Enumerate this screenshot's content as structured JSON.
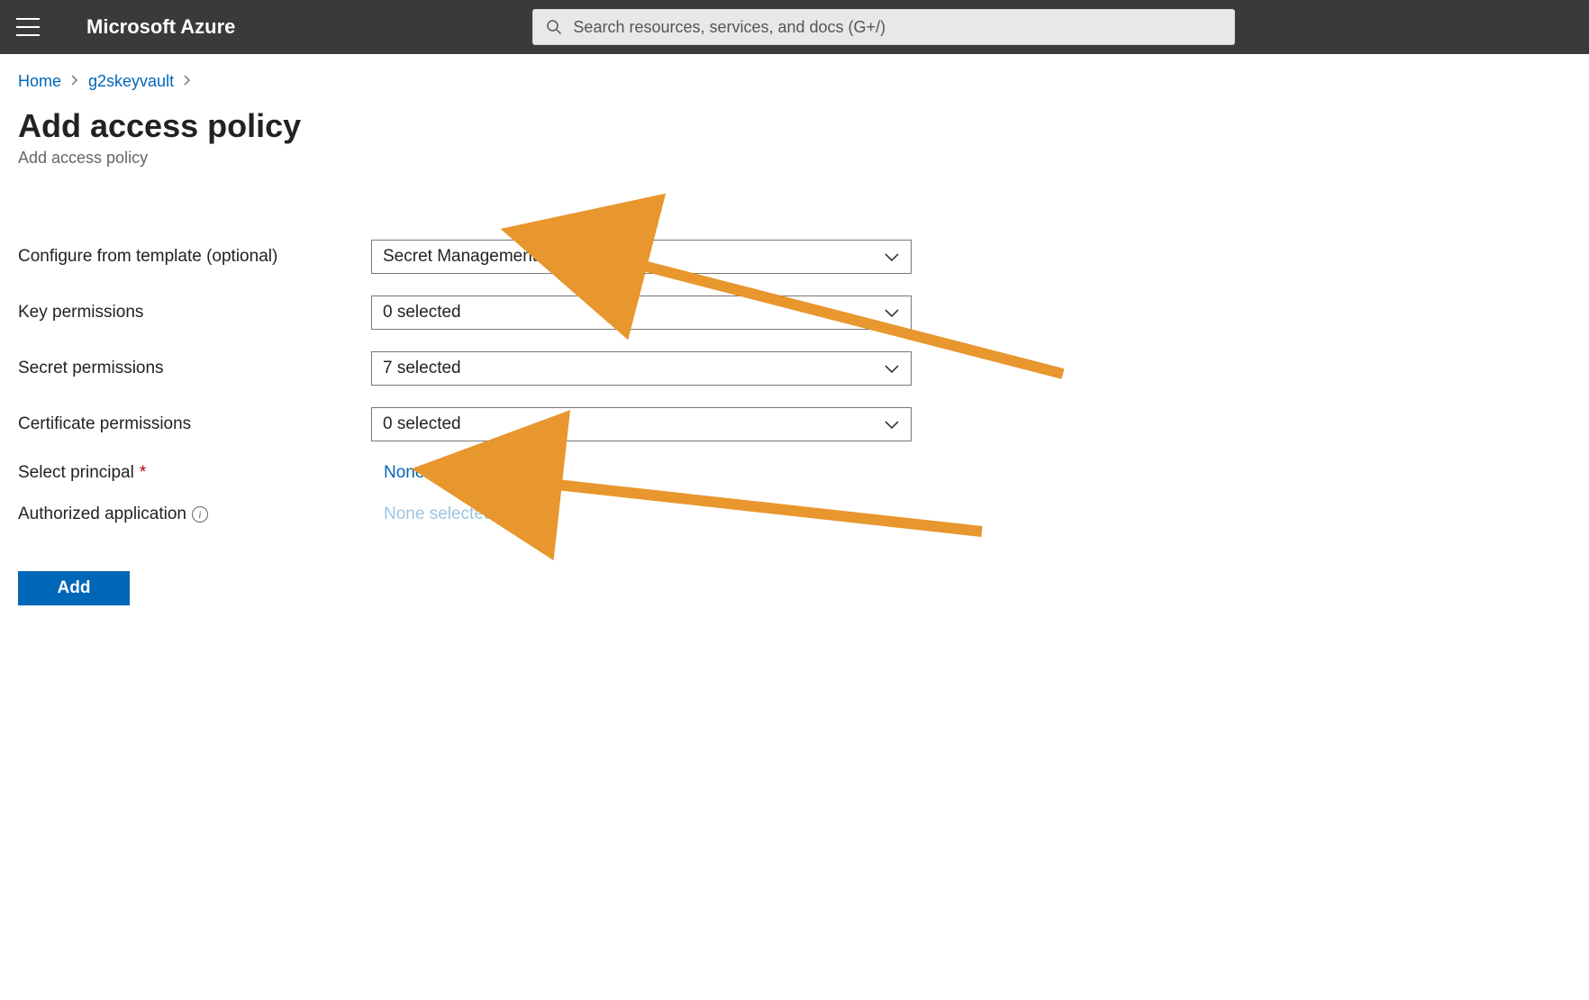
{
  "header": {
    "brand": "Microsoft Azure",
    "search_placeholder": "Search resources, services, and docs (G+/)"
  },
  "breadcrumb": {
    "home": "Home",
    "vault": "g2skeyvault"
  },
  "page": {
    "title": "Add access policy",
    "subtitle": "Add access policy"
  },
  "form": {
    "template_label": "Configure from template (optional)",
    "template_value": "Secret Management",
    "key_perm_label": "Key permissions",
    "key_perm_value": "0 selected",
    "secret_perm_label": "Secret permissions",
    "secret_perm_value": "7 selected",
    "cert_perm_label": "Certificate permissions",
    "cert_perm_value": "0 selected",
    "principal_label": "Select principal",
    "principal_value": "None selected",
    "authapp_label": "Authorized application",
    "authapp_value": "None selected",
    "add_button": "Add"
  },
  "colors": {
    "accent": "#0066b8",
    "annotation": "#e8962e"
  }
}
